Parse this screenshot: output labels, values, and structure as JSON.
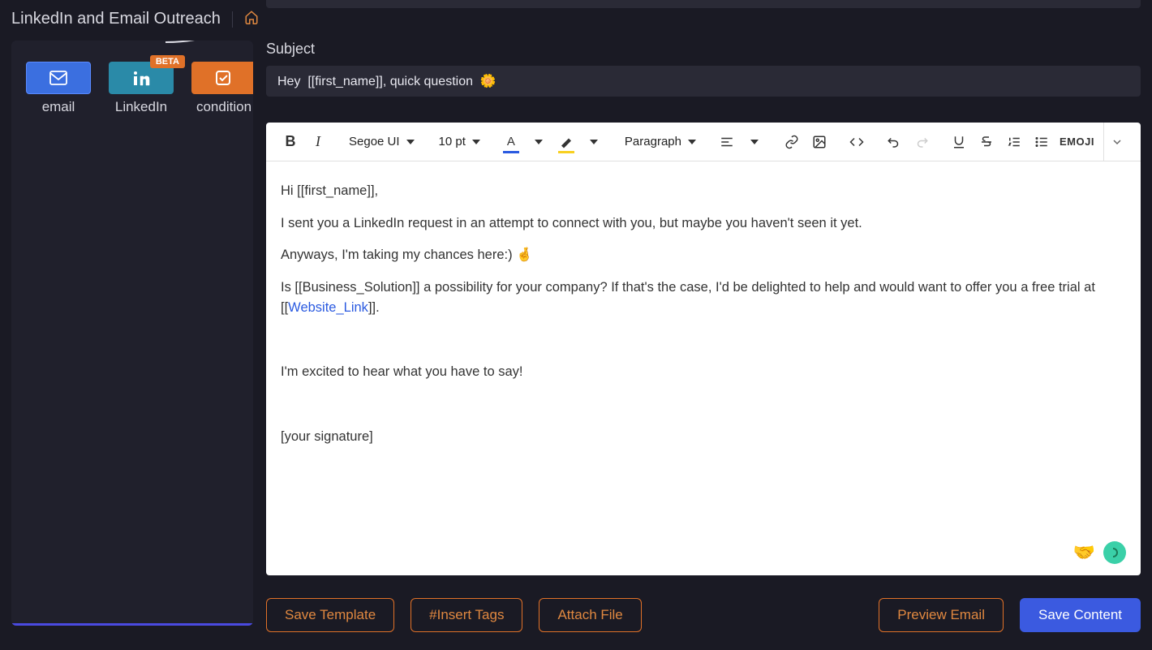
{
  "header": {
    "title": "LinkedIn and Email Outreach"
  },
  "sidebar": {
    "nodes": {
      "email": {
        "label": "email"
      },
      "linkedin": {
        "label": "LinkedIn",
        "badge": "BETA"
      },
      "condition": {
        "label": "condition"
      }
    }
  },
  "subject": {
    "label": "Subject",
    "value": "Hey  [[first_name]], quick question  🌼"
  },
  "toolbar": {
    "font_family": "Segoe UI",
    "font_size": "10 pt",
    "block_format": "Paragraph",
    "emoji_label": "EMOJI"
  },
  "body": {
    "greeting": "Hi [[first_name]],",
    "p1": "I sent you a LinkedIn request in an attempt to connect with you, but maybe you haven't seen it yet.",
    "p2": "Anyways, I'm taking my chances here:) 🤞",
    "p3_pre": "Is [[Business_Solution]] a possibility for your company? If that's the case, I'd be delighted to help and would want to offer you a free trial at [[",
    "p3_link": "Website_Link",
    "p3_post": "]].",
    "p4": "I'm excited to hear what you have to say!",
    "signature": "[your signature]"
  },
  "actions": {
    "save_template": "Save Template",
    "insert_tags": "#Insert Tags",
    "attach_file": "Attach File",
    "preview_email": "Preview Email",
    "save_content": "Save Content"
  }
}
